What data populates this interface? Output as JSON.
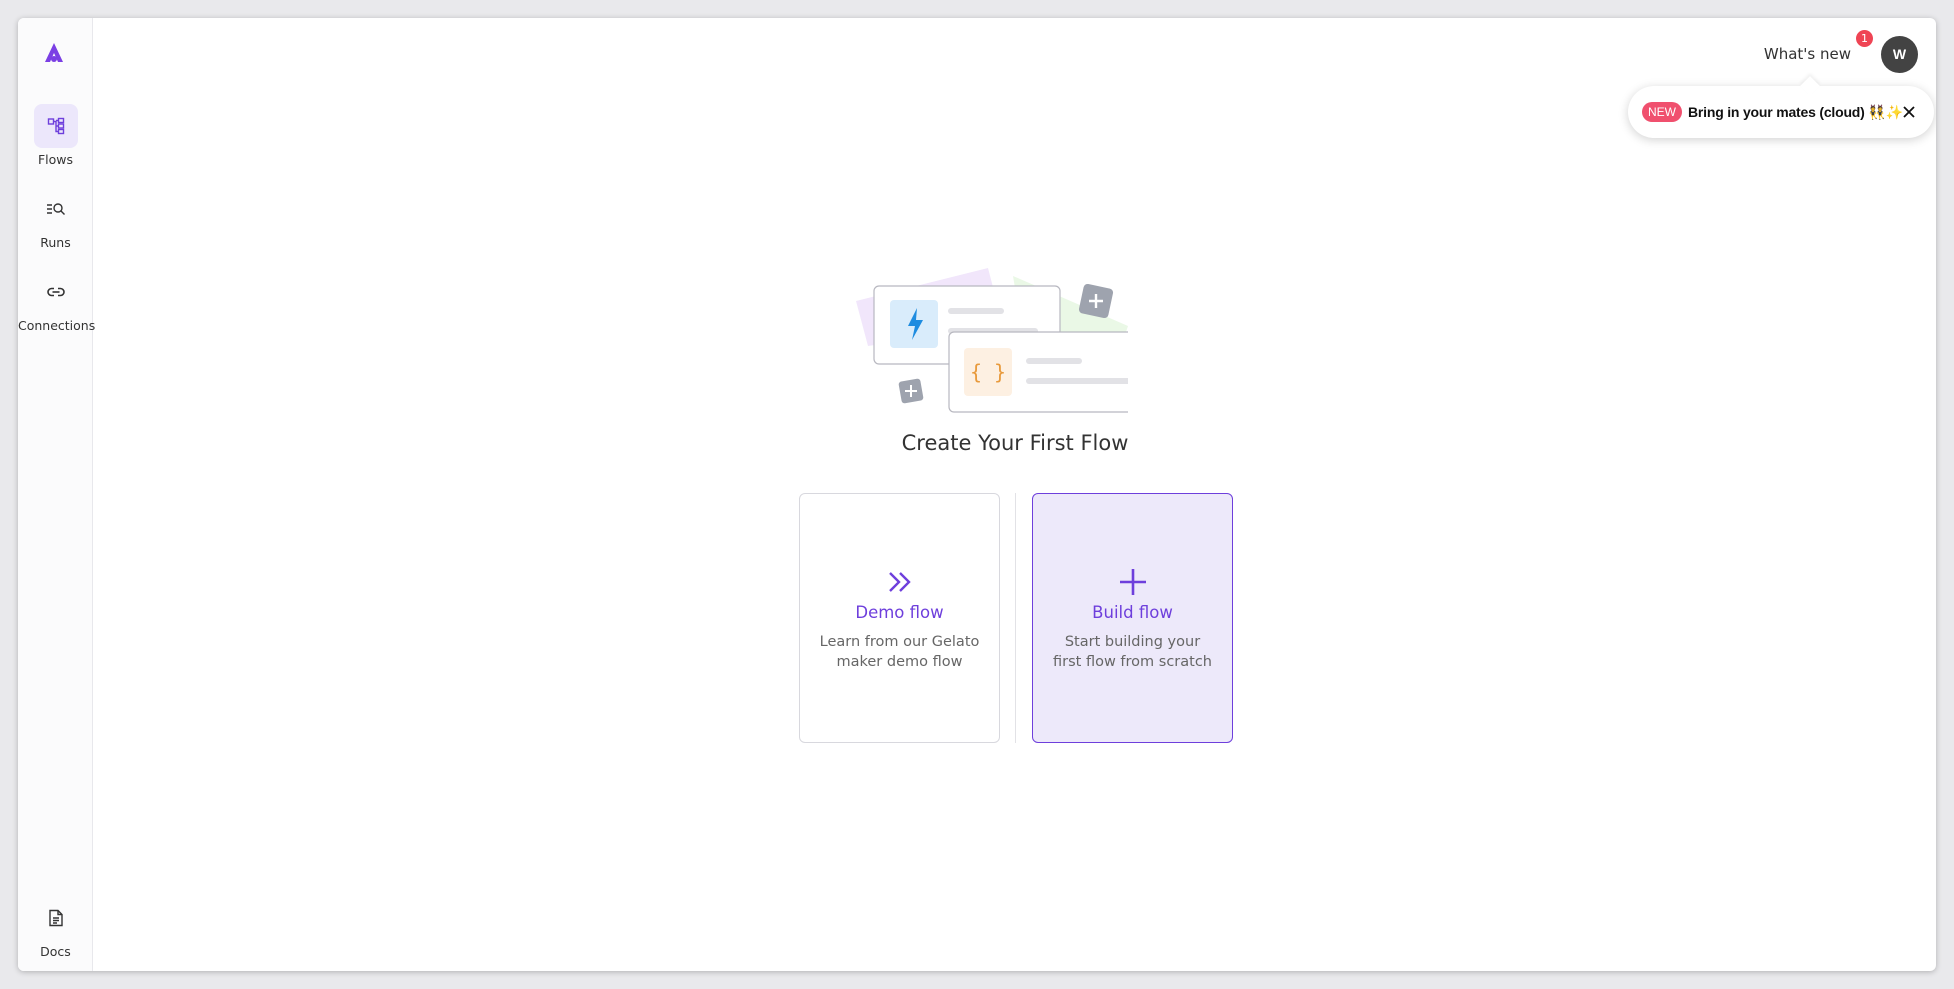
{
  "sidebar": {
    "items": [
      {
        "label": "Flows",
        "icon": "flows-icon",
        "active": true
      },
      {
        "label": "Runs",
        "icon": "runs-icon"
      },
      {
        "label": "Connections",
        "icon": "link-icon"
      }
    ],
    "bottom_items": [
      {
        "label": "Docs",
        "icon": "docs-icon"
      }
    ]
  },
  "header": {
    "whats_new": "What's new",
    "notification_count": "1",
    "avatar_initial": "W"
  },
  "toast": {
    "badge": "NEW",
    "text": "Bring in your mates (cloud) 👯✨"
  },
  "main": {
    "title": "Create Your First Flow",
    "cards": [
      {
        "title": "Demo flow",
        "description": "Learn from our Gelato maker demo flow"
      },
      {
        "title": "Build flow",
        "description": "Start building your first flow from scratch"
      }
    ]
  },
  "colors": {
    "accent": "#6e3fdc",
    "accent_light": "#ede9fa",
    "badge": "#ef4454"
  }
}
